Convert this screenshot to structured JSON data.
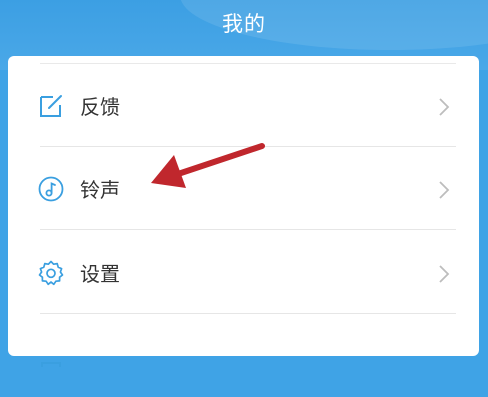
{
  "header": {
    "title": "我的"
  },
  "menu": {
    "items": [
      {
        "label": "反馈",
        "icon": "edit-icon"
      },
      {
        "label": "铃声",
        "icon": "music-note-icon"
      },
      {
        "label": "设置",
        "icon": "gear-icon"
      }
    ]
  },
  "colors": {
    "header_bg": "#3fa3e6",
    "icon_color": "#3a9fe0",
    "annotation_arrow": "#c0272d"
  }
}
